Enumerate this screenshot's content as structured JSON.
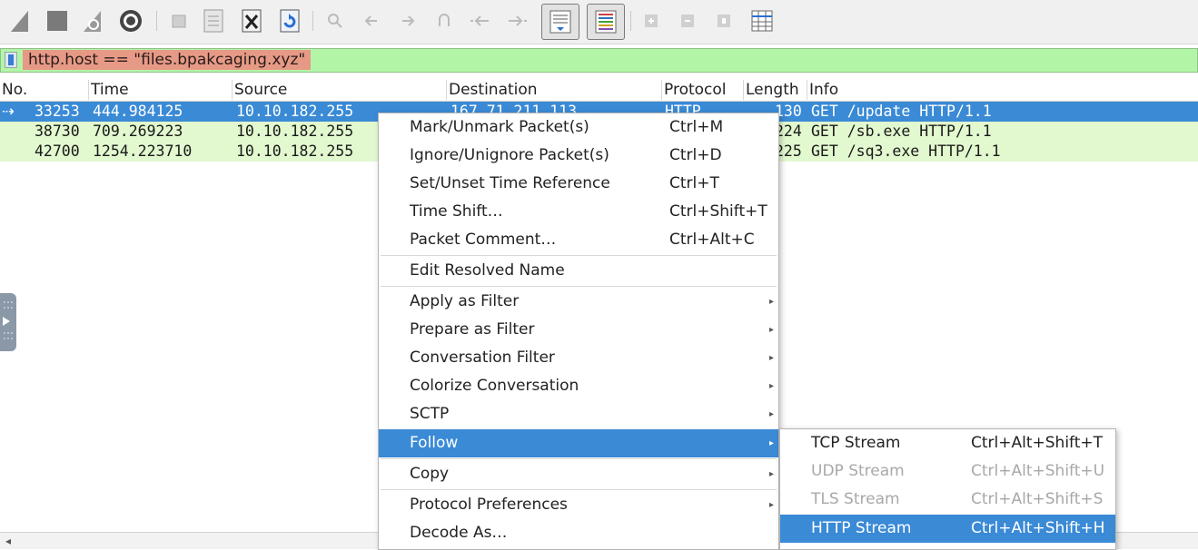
{
  "toolbar": {
    "icons": [
      "shark-fin-start-icon",
      "stop-square-icon",
      "restart-shark-fin-icon",
      "capture-options-gear-icon",
      "open-file-icon",
      "save-file-icon",
      "close-file-icon",
      "reload-file-icon",
      "find-packet-icon",
      "go-back-icon",
      "go-forward-icon",
      "go-to-packet-icon",
      "first-packet-icon",
      "last-packet-icon",
      "auto-scroll-icon",
      "colorize-icon",
      "zoom-in-icon",
      "zoom-out-icon",
      "normal-size-icon",
      "resize-columns-icon"
    ]
  },
  "filter": {
    "text": "http.host == \"files.bpakcaging.xyz\""
  },
  "columns": [
    "No.",
    "Time",
    "Source",
    "Destination",
    "Protocol",
    "Length",
    "Info"
  ],
  "packets": [
    {
      "no": "33253",
      "time": "444.984125",
      "source": "10.10.182.255",
      "destination": "167.71.211.113",
      "protocol": "HTTP",
      "length": "130",
      "info": "GET /update HTTP/1.1"
    },
    {
      "no": "38730",
      "time": "709.269223",
      "source": "10.10.182.255",
      "destination": "",
      "protocol": "",
      "length": "224",
      "info": "GET /sb.exe HTTP/1.1"
    },
    {
      "no": "42700",
      "time": "1254.223710",
      "source": "10.10.182.255",
      "destination": "",
      "protocol": "",
      "length": "225",
      "info": "GET /sq3.exe HTTP/1.1"
    }
  ],
  "context_menu": {
    "items": [
      {
        "label": "Mark/Unmark Packet(s)",
        "shortcut": "Ctrl+M"
      },
      {
        "label": "Ignore/Unignore Packet(s)",
        "shortcut": "Ctrl+D"
      },
      {
        "label": "Set/Unset Time Reference",
        "shortcut": "Ctrl+T"
      },
      {
        "label": "Time Shift…",
        "shortcut": "Ctrl+Shift+T"
      },
      {
        "label": "Packet Comment…",
        "shortcut": "Ctrl+Alt+C"
      },
      {
        "label": "Edit Resolved Name",
        "shortcut": ""
      },
      {
        "label": "Apply as Filter",
        "shortcut": ""
      },
      {
        "label": "Prepare as Filter",
        "shortcut": ""
      },
      {
        "label": "Conversation Filter",
        "shortcut": ""
      },
      {
        "label": "Colorize Conversation",
        "shortcut": ""
      },
      {
        "label": "SCTP",
        "shortcut": ""
      },
      {
        "label": "Follow",
        "shortcut": ""
      },
      {
        "label": "Copy",
        "shortcut": ""
      },
      {
        "label": "Protocol Preferences",
        "shortcut": ""
      },
      {
        "label": "Decode As…",
        "shortcut": ""
      }
    ],
    "submenu_arrow": "▸"
  },
  "follow_submenu": {
    "items": [
      {
        "label": "TCP Stream",
        "shortcut": "Ctrl+Alt+Shift+T"
      },
      {
        "label": "UDP Stream",
        "shortcut": "Ctrl+Alt+Shift+U"
      },
      {
        "label": "TLS Stream",
        "shortcut": "Ctrl+Alt+Shift+S"
      },
      {
        "label": "HTTP Stream",
        "shortcut": "Ctrl+Alt+Shift+H"
      }
    ]
  },
  "scroll_arrow": "◂",
  "colors": {
    "selection": "#3a8ad6",
    "filter_valid": "#b3f5a7",
    "row_http": "#e2f8cf"
  }
}
